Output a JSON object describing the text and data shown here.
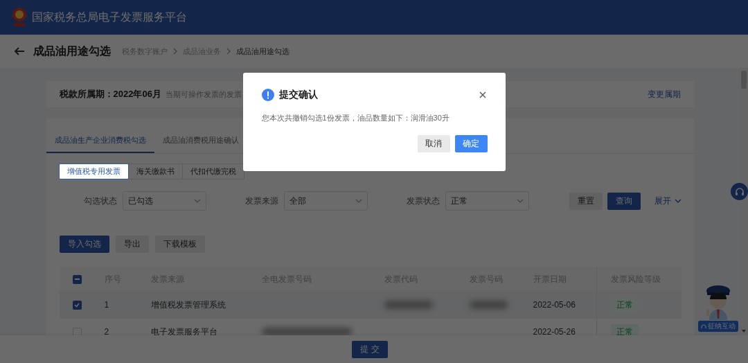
{
  "header": {
    "title": "国家税务总局电子发票服务平台"
  },
  "page": {
    "title": "成品油用途勾选",
    "breadcrumbs": [
      {
        "label": "税务数字账户",
        "current": false
      },
      {
        "label": "成品油业务",
        "current": false
      },
      {
        "label": "成品油用途勾选",
        "current": true
      }
    ]
  },
  "period_bar": {
    "label": "税款所属期：2022年06月",
    "note": "当期可操作发票的发票",
    "link": "变更属期"
  },
  "tabs": [
    {
      "label": "成品油生产企业消费税勾选",
      "selected": true
    },
    {
      "label": "成品油消费税用途确认",
      "selected": false
    }
  ],
  "invoice_types": [
    {
      "label": "增值税专用发票",
      "selected": true
    },
    {
      "label": "海关缴款书",
      "selected": false
    },
    {
      "label": "代扣代缴完税",
      "selected": false
    }
  ],
  "filters": [
    {
      "label": "勾选状态",
      "value": "已勾选"
    },
    {
      "label": "发票来源",
      "value": "全部"
    },
    {
      "label": "发票状态",
      "value": "正常"
    }
  ],
  "filter_buttons": [
    {
      "label": "重置",
      "kind": "default"
    },
    {
      "label": "查询",
      "kind": "primary"
    }
  ],
  "expand_link": "展开",
  "actions": [
    {
      "label": "导入勾选",
      "kind": "primary"
    },
    {
      "label": "导出",
      "kind": "default"
    },
    {
      "label": "下载模板",
      "kind": "default"
    }
  ],
  "table": {
    "select_all": {
      "partial": true
    },
    "columns": [
      "序号",
      "发票来源",
      "全电发票号码",
      "发票代码",
      "发票号码",
      "开票日期",
      "发票风险等级"
    ],
    "rows": [
      {
        "selected": true,
        "index": "1",
        "source": "增值税发票管理系统",
        "full_number_redacted": false,
        "code_redacted": true,
        "number_redacted": true,
        "date": "2022-05-06",
        "risk": "正常"
      },
      {
        "selected": false,
        "index": "2",
        "source": "电子发票服务平台",
        "full_number_redacted": true,
        "code_redacted": false,
        "number_redacted": false,
        "date": "2022-05-26",
        "risk": "正常"
      }
    ]
  },
  "footer": {
    "submit": "提 交"
  },
  "help": {
    "label": "征纳互动"
  },
  "dialog": {
    "title": "提交确认",
    "message": "您本次共撤销勾选1份发票，油品数量如下：润滑油30升",
    "buttons": [
      {
        "label": "取消",
        "kind": "default"
      },
      {
        "label": "确定",
        "kind": "primary"
      }
    ]
  }
}
